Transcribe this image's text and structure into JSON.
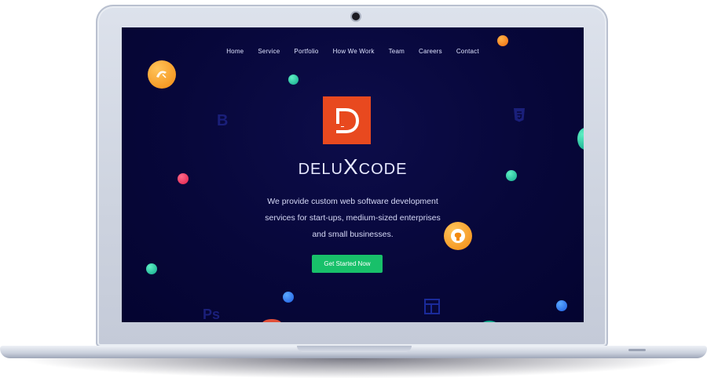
{
  "nav": {
    "items": [
      {
        "label": "Home"
      },
      {
        "label": "Service"
      },
      {
        "label": "Portfolio"
      },
      {
        "label": "How We Work"
      },
      {
        "label": "Team"
      },
      {
        "label": "Careers"
      },
      {
        "label": "Contact"
      }
    ]
  },
  "hero": {
    "logo_letter": "D",
    "brand_part1": "DELU",
    "brand_x": "X",
    "brand_part2": "CODE",
    "tagline_line1": "We provide custom web software development",
    "tagline_line2": "services for start-ups, medium-sized enterprises",
    "tagline_line3": "and small businesses.",
    "cta_label": "Get Started Now"
  },
  "decor": {
    "faded_b": "B",
    "faded_ps": "Ps"
  },
  "colors": {
    "background": "#07073a",
    "logo": "#e8491f",
    "cta": "#18c06a",
    "badge": "#f5a020"
  },
  "icons": [
    "mysql-icon",
    "github-icon",
    "html5-icon",
    "bootstrap-icon",
    "photoshop-icon",
    "layout-icon"
  ]
}
